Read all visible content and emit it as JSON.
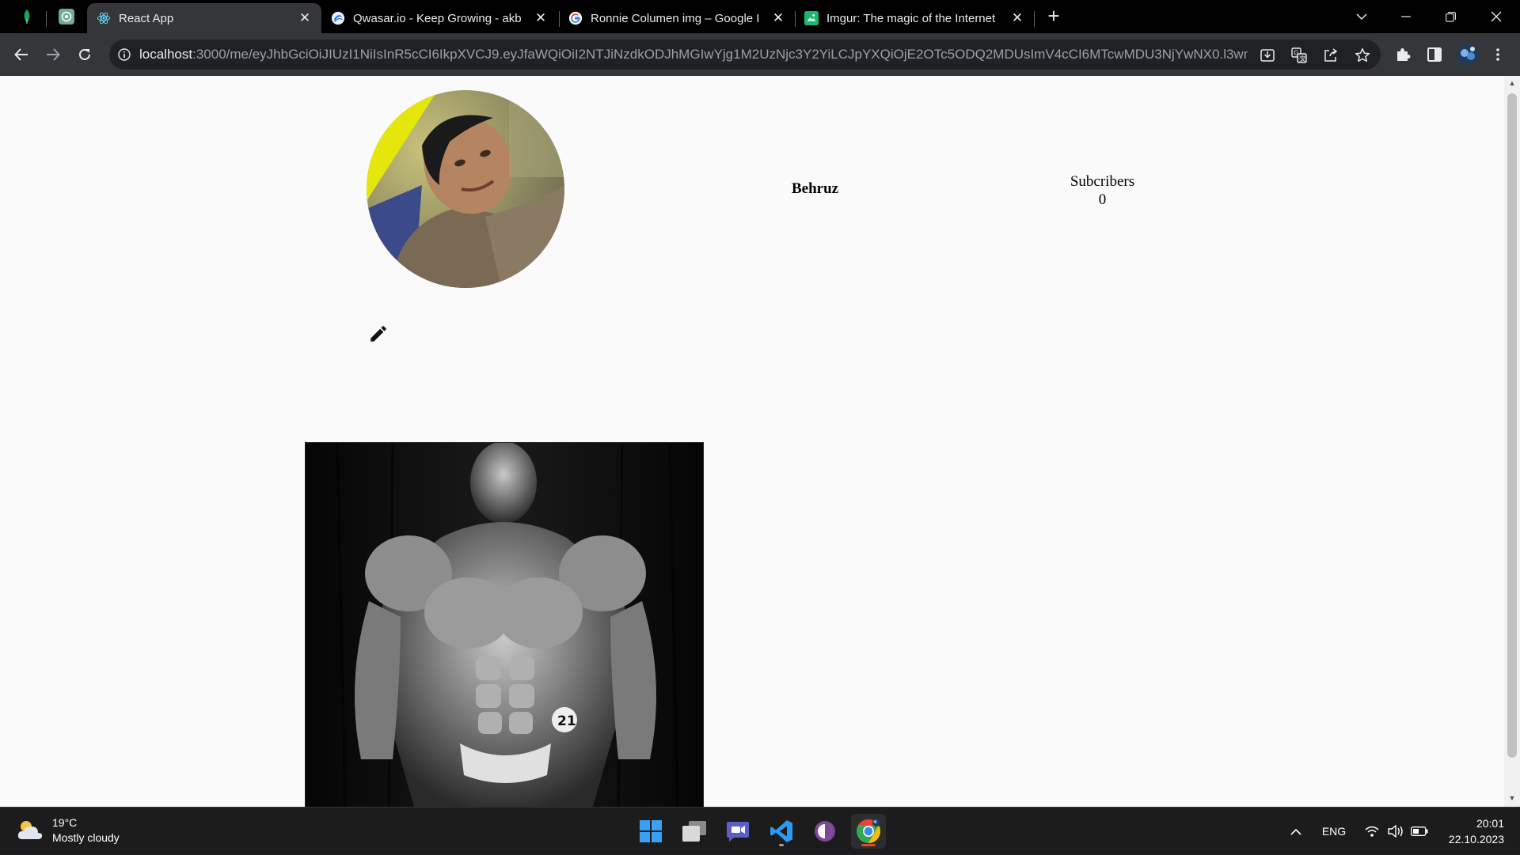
{
  "browser": {
    "tabs": [
      {
        "title": "React App",
        "active": true
      },
      {
        "title": "Qwasar.io - Keep Growing - akb",
        "active": false
      },
      {
        "title": "Ronnie Columen img – Google I",
        "active": false
      },
      {
        "title": "Imgur: The magic of the Internet",
        "active": false
      }
    ],
    "url_host": "localhost",
    "url_rest": ":3000/me/eyJhbGciOiJIUzI1NiIsInR5cCI6IkpXVCJ9.eyJfaWQiOiI2NTJiNzdkODJhMGIwYjg1M2UzNjc3Y2YiLCJpYXQiOjE2OTc5ODQ2MDUsImV4cCI6MTcwMDU3NjYwNX0.l3wm..."
  },
  "profile": {
    "username": "Behruz",
    "subscribers_label": "Subcribers",
    "subscribers_count": "0"
  },
  "taskbar": {
    "weather_temp": "19°C",
    "weather_desc": "Mostly cloudy",
    "language": "ENG",
    "time": "20:01",
    "date": "22.10.2023"
  },
  "colors": {
    "page_bg": "#fafafa",
    "tab_active": "#35363a",
    "tabstrip": "#000000",
    "taskbar": "#1c1c1c",
    "chrome_accent": "#ea4335"
  }
}
